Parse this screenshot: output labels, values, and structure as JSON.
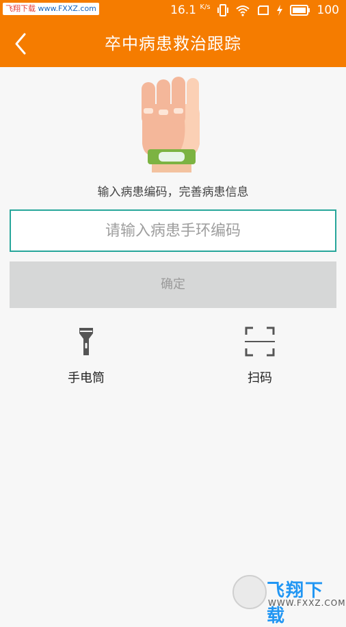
{
  "statusbar": {
    "watermark_text": "飞翔下载",
    "watermark_domain": "www.FXXZ.com",
    "speed": "16.1",
    "speed_unit": "K/s",
    "battery": "100",
    "icons": [
      "vibrate-icon",
      "wifi-icon",
      "screen-icon",
      "charging-icon",
      "battery-icon"
    ]
  },
  "header": {
    "title": "卒中病患救治跟踪",
    "background": "#f57c00",
    "back_icon": "chevron-left-icon"
  },
  "main": {
    "illustration": "hand-wristband-icon",
    "prompt": "输入病患编码，完善病患信息",
    "input": {
      "value": "",
      "placeholder": "请输入病患手环编码",
      "border_color": "#26a69a"
    },
    "confirm_label": "确定",
    "tools": [
      {
        "label": "手电筒",
        "icon": "flashlight-icon"
      },
      {
        "label": "扫码",
        "icon": "scan-icon"
      }
    ]
  },
  "watermark": {
    "brand": "飞翔下载",
    "url": "WWW.FXXZ.COM"
  }
}
